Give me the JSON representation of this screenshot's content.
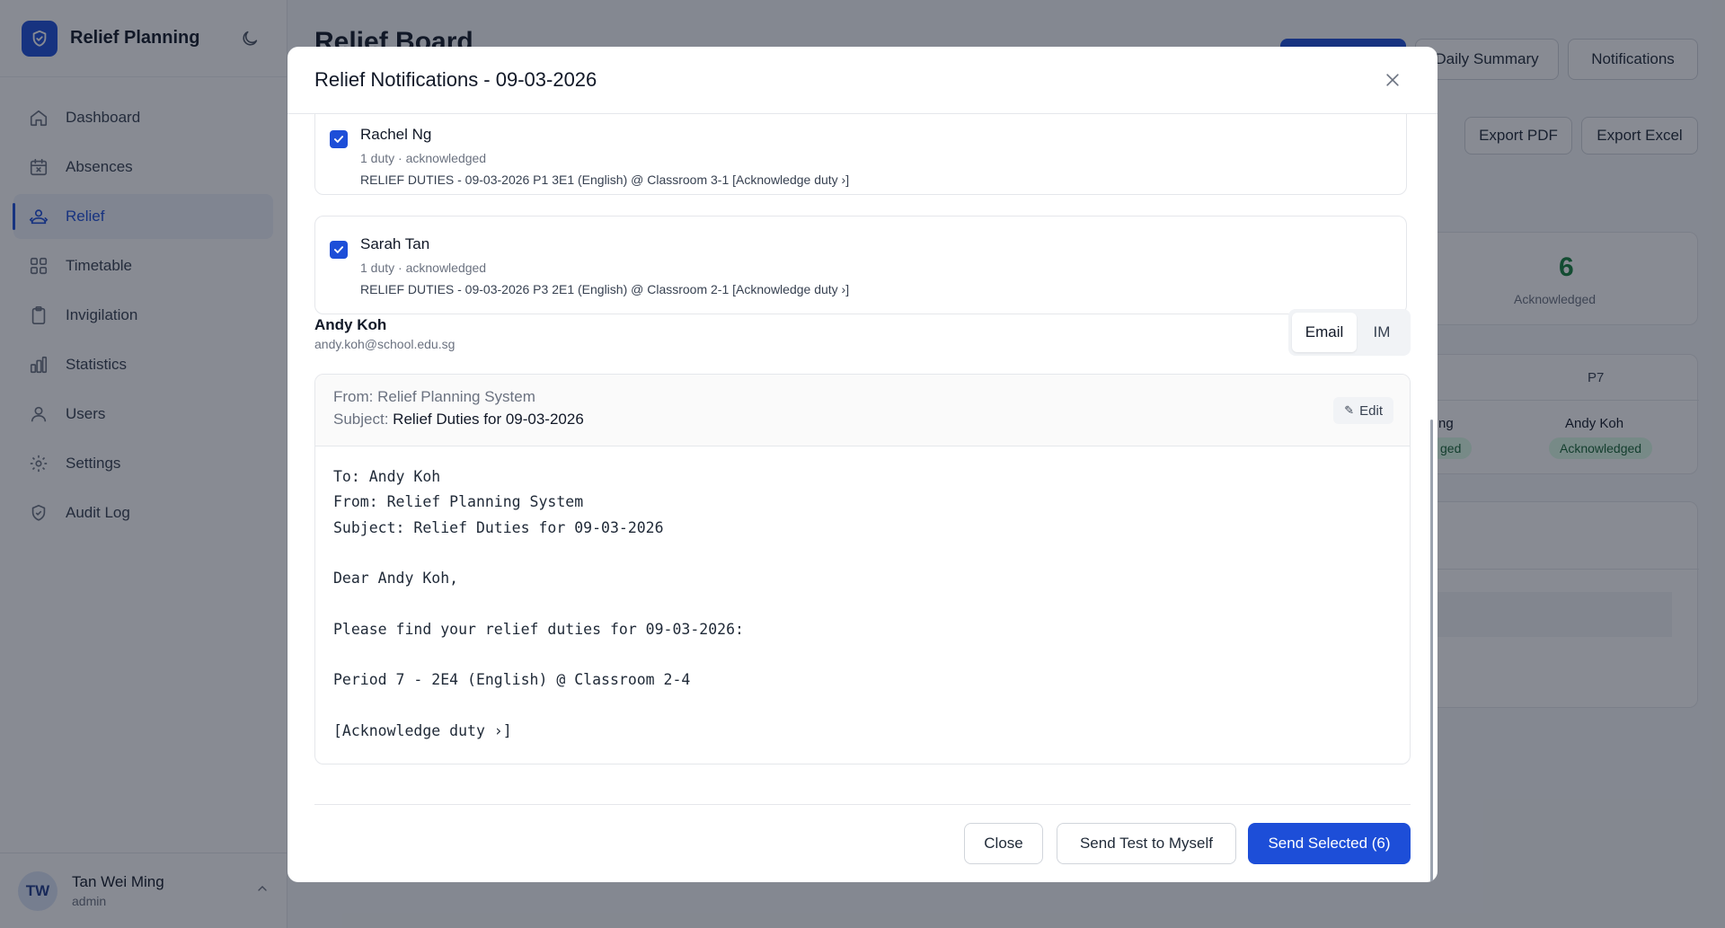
{
  "app": {
    "title": "Relief Planning"
  },
  "sidebar": {
    "items": [
      {
        "label": "Dashboard",
        "icon": "home-icon"
      },
      {
        "label": "Absences",
        "icon": "calendar-x-icon"
      },
      {
        "label": "Relief",
        "icon": "users-swap-icon",
        "active": true
      },
      {
        "label": "Timetable",
        "icon": "grid-icon"
      },
      {
        "label": "Invigilation",
        "icon": "clipboard-icon"
      },
      {
        "label": "Statistics",
        "icon": "bar-chart-icon"
      },
      {
        "label": "Users",
        "icon": "user-icon"
      },
      {
        "label": "Settings",
        "icon": "gear-icon"
      },
      {
        "label": "Audit Log",
        "icon": "shield-check-icon"
      }
    ]
  },
  "user": {
    "initials": "TW",
    "name": "Tan Wei Ming",
    "role": "admin"
  },
  "page": {
    "title": "Relief Board",
    "actions": {
      "daily_summary": "Daily Summary",
      "notifications": "Notifications",
      "export_pdf": "Export PDF",
      "export_excel": "Export Excel"
    },
    "stat": {
      "value": "6",
      "label": "Acknowledged"
    },
    "grid": {
      "period_header": "P7",
      "partial_name": "ng",
      "partial_badge": "ged",
      "cell_name": "Andy Koh",
      "cell_status": "Acknowledged"
    }
  },
  "modal": {
    "title": "Relief Notifications - 09-03-2026",
    "recipients": [
      {
        "name": "Rachel Ng",
        "meta": "1 duty · acknowledged",
        "duty": "RELIEF DUTIES - 09-03-2026 P1 3E1 (English) @ Classroom 3-1 [Acknowledge duty ›]",
        "checked": true
      },
      {
        "name": "Sarah Tan",
        "meta": "1 duty · acknowledged",
        "duty": "RELIEF DUTIES - 09-03-2026 P3 2E1 (English) @ Classroom 2-1 [Acknowledge duty ›]",
        "checked": true
      }
    ],
    "preview": {
      "name": "Andy Koh",
      "email": "andy.koh@school.edu.sg",
      "channels": {
        "email": "Email",
        "im": "IM",
        "selected": "Email"
      },
      "from_label": "From:",
      "from_value": "Relief Planning System",
      "subject_label": "Subject:",
      "subject_value": "Relief Duties for 09-03-2026",
      "edit_label": "Edit",
      "body_lines": [
        "To: Andy Koh",
        "From: Relief Planning System",
        "Subject: Relief Duties for 09-03-2026",
        "",
        "Dear Andy Koh,",
        "",
        "Please find your relief duties for 09-03-2026:",
        "",
        "Period 7 - 2E4 (English) @ Classroom 2-4",
        "",
        "[Acknowledge duty ›]"
      ]
    },
    "footer": {
      "close": "Close",
      "send_test": "Send Test to Myself",
      "send_selected": "Send Selected (6)"
    }
  },
  "colors": {
    "accent": "#1d4ed8",
    "success": "#15803d",
    "success_bg": "#dcfce7"
  }
}
